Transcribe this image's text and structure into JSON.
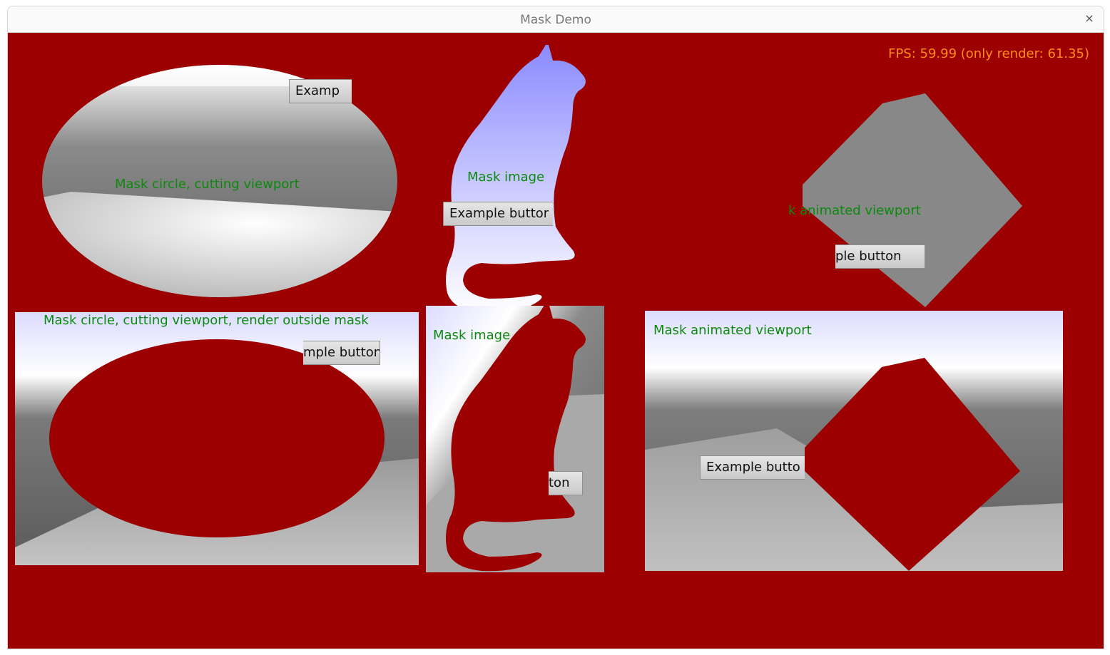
{
  "window": {
    "title": "Mask Demo",
    "close_symbol": "×"
  },
  "fps_text": "FPS: 59.99 (only render: 61.35)",
  "panels": {
    "circle_cut": {
      "label": "Mask circle, cutting viewport",
      "button": "Examp"
    },
    "mask_image": {
      "label": "Mask image",
      "button": "Example buttor"
    },
    "animated": {
      "label": "k animated viewport",
      "button": "ple button"
    },
    "circle_outside": {
      "label": "Mask circle, cutting viewport, render outside mask",
      "button": "mple button"
    },
    "mask_image_outside": {
      "label": "Mask image",
      "button": "ton"
    },
    "animated_outside": {
      "label": "Mask animated viewport",
      "button": "Example butto"
    }
  },
  "colors": {
    "background_red": "#9d0000",
    "label_green": "#0d8a0d",
    "fps_orange": "#ff8c1a"
  }
}
